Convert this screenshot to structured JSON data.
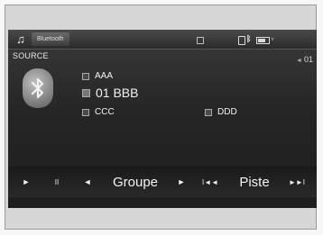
{
  "status_bar": {
    "active_tab": "Bluetooth",
    "icons": [
      "music-note-icon",
      "square-icon",
      "phone-icon",
      "bluetooth-icon",
      "battery-icon",
      "signal-icon"
    ]
  },
  "source": {
    "label": "SOURCE",
    "track_number": "01",
    "bluetooth_logo": "bluetooth-logo"
  },
  "now_playing": {
    "artist": "AAA",
    "title": "01 BBB",
    "album": "CCC",
    "genre": "DDD"
  },
  "controls": {
    "play": "►",
    "pause": "II",
    "group_prev": "◄",
    "group_label": "Groupe",
    "group_next": "►",
    "track_prev": "I◄◄",
    "track_label": "Piste",
    "track_next": "►►I"
  },
  "colors": {
    "screen_bg": "#262626",
    "text": "#ededed"
  }
}
